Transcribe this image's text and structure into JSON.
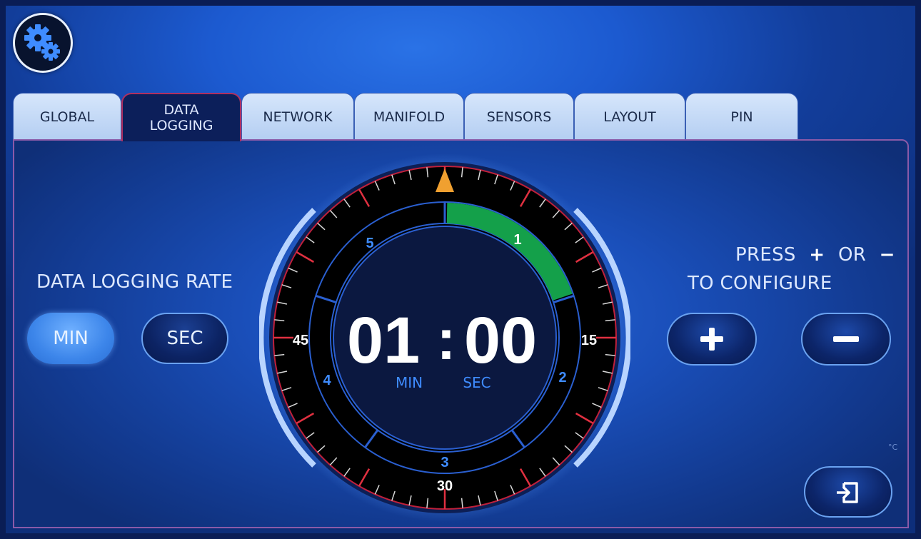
{
  "toolbar": {
    "settings_icon": "gears-icon"
  },
  "tabs": [
    {
      "label": "GLOBAL",
      "active": false
    },
    {
      "label": "DATA LOGGING",
      "active": true
    },
    {
      "label": "NETWORK",
      "active": false
    },
    {
      "label": "MANIFOLD",
      "active": false
    },
    {
      "label": "SENSORS",
      "active": false
    },
    {
      "label": "LAYOUT",
      "active": false
    },
    {
      "label": "PIN",
      "active": false
    }
  ],
  "rate": {
    "title": "DATA LOGGING RATE",
    "min_label": "MIN",
    "sec_label": "SEC",
    "selected": "MIN"
  },
  "dial": {
    "time_min": "01",
    "time_sep": ":",
    "time_sec": "00",
    "unit_min": "MIN",
    "unit_sec": "SEC",
    "outer_labels": {
      "top_right": "15",
      "bottom": "30",
      "left": "45"
    },
    "inner_labels": [
      "1",
      "2",
      "3",
      "4",
      "5"
    ],
    "selected_segment": 1,
    "colors": {
      "selected": "#14a04a",
      "pointer": "#f0a030",
      "ticks_major": "#e03040",
      "ring": "#2a5fd0"
    }
  },
  "configure": {
    "press_label": "PRESS",
    "plus_symbol": "+",
    "or_label": "OR",
    "minus_symbol": "−",
    "to_configure": "TO CONFIGURE"
  },
  "footer": {
    "unit_hint": "°C"
  },
  "colors": {
    "accent": "#3d86ea",
    "background": "#1a4fba",
    "active_tab": "#0c1f5a"
  }
}
